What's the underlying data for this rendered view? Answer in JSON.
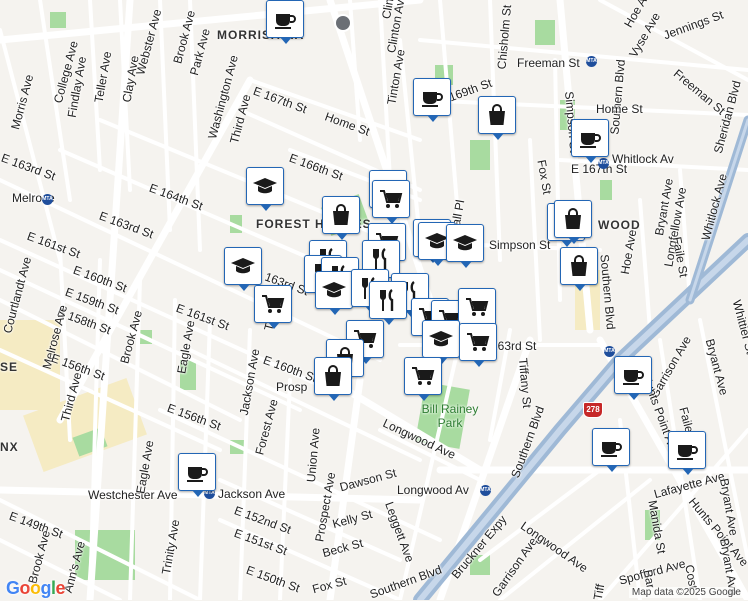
{
  "colors": {
    "pin_border": "#2366b5",
    "park": "#a8dba0",
    "road": "#ffffff",
    "highway": "#9fb9d6",
    "land": "#f5f3ef"
  },
  "neighborhoods": [
    "MORRISANIA",
    "FOREST HOUSES",
    "WOOD",
    "SE",
    "NX"
  ],
  "parks": [
    {
      "name": "Bill Rainey Park"
    }
  ],
  "streets": [
    "Morris Ave",
    "College Ave",
    "Findlay Ave",
    "Teller Ave",
    "Clay Ave",
    "Webster Ave",
    "Brook Ave",
    "Park Ave",
    "Washington Ave",
    "Third Ave",
    "E 167th St",
    "E 166th St",
    "Home St",
    "Tinton Ave",
    "E 169th St",
    "Chisholm St",
    "Freeman St",
    "Southern Blvd",
    "Vyse Ave",
    "Jennings St",
    "Hoe Ave",
    "Freeman St",
    "Home St",
    "Simpson St",
    "Whitlock Av",
    "E 167th St",
    "Sheridan Blvd",
    "Whitlock Ave",
    "Longfellow Ave",
    "Bryant Ave",
    "E 163rd St",
    "E 164th St",
    "E 163rd St",
    "E 161st St",
    "Melrose",
    "E 160th St",
    "E 159th St",
    "E 158th St",
    "Courtlandt Ave",
    "Melrose Ave",
    "E 156th St",
    "Third Ave",
    "Brook Ave",
    "Eagle Ave",
    "Trinity Av",
    "E 161st St",
    "Jackson Ave",
    "E 160th St",
    "Prosp",
    "Forest Ave",
    "E 156th St",
    "163rd St",
    "Hall Pl",
    "Simpson St",
    "Fox St",
    "Hoe Ave",
    "Faile St",
    "Southern Blvd",
    "163rd St",
    "Tiffany St",
    "Southern Blvd",
    "Longwood Ave",
    "Longwood Av",
    "Dawson St",
    "Union Ave",
    "Prospect Ave",
    "Kelly St",
    "Leggett Ave",
    "Beck St",
    "E 152nd St",
    "E 151st St",
    "E 150th St",
    "E 149th St",
    "Westchester Ave",
    "Jackson Ave",
    "Trinity Ave",
    "Eagle Ave",
    "Brook Ave",
    "Ann's Ave",
    "Fox St",
    "Southern Blvd",
    "Bruckner Expy",
    "Garrison Ave",
    "Longwood Ave",
    "Spofford Ave",
    "Lafayette Ave",
    "Manida St",
    "Hunts Point Ave",
    "Bryant Ave",
    "Garrison Ave",
    "Faile St",
    "Hunts Point Ave",
    "Bryant Ave",
    "Whittier St",
    "Clinton Ave",
    "Tiff",
    "Cost",
    "Bar",
    "Bryant Ave",
    "Clint"
  ],
  "route_shields": [
    "278"
  ],
  "transit": [
    "MTA"
  ],
  "google_logo": "Google",
  "attribution": "Map data ©2025 Google",
  "markers": [
    {
      "icon": "coffee-icon"
    },
    {
      "icon": "coffee-icon"
    },
    {
      "icon": "shopping-bag-icon"
    },
    {
      "icon": "coffee-icon"
    },
    {
      "icon": "graduation-cap-icon"
    },
    {
      "icon": "shopping-cart-icon"
    },
    {
      "icon": "shopping-cart-icon"
    },
    {
      "icon": "shopping-bag-icon"
    },
    {
      "icon": "graduation-cap-icon"
    },
    {
      "icon": "shopping-cart-icon"
    },
    {
      "icon": "graduation-cap-icon"
    },
    {
      "icon": "graduation-cap-icon"
    },
    {
      "icon": "graduation-cap-icon"
    },
    {
      "icon": "shopping-bag-icon"
    },
    {
      "icon": "shopping-bag-icon"
    },
    {
      "icon": "shopping-bag-icon"
    },
    {
      "icon": "restaurant-icon"
    },
    {
      "icon": "restaurant-icon"
    },
    {
      "icon": "restaurant-icon"
    },
    {
      "icon": "restaurant-icon"
    },
    {
      "icon": "graduation-cap-icon"
    },
    {
      "icon": "restaurant-icon"
    },
    {
      "icon": "restaurant-icon"
    },
    {
      "icon": "restaurant-icon"
    },
    {
      "icon": "shopping-cart-icon"
    },
    {
      "icon": "shopping-cart-icon"
    },
    {
      "icon": "shopping-cart-icon"
    },
    {
      "icon": "shopping-cart-icon"
    },
    {
      "icon": "graduation-cap-icon"
    },
    {
      "icon": "shopping-cart-icon"
    },
    {
      "icon": "shopping-cart-icon"
    },
    {
      "icon": "shopping-bag-icon"
    },
    {
      "icon": "shopping-cart-icon"
    },
    {
      "icon": "coffee-icon"
    },
    {
      "icon": "coffee-icon"
    },
    {
      "icon": "coffee-icon"
    },
    {
      "icon": "coffee-icon"
    },
    {
      "icon": "shopping-bag-icon"
    }
  ]
}
